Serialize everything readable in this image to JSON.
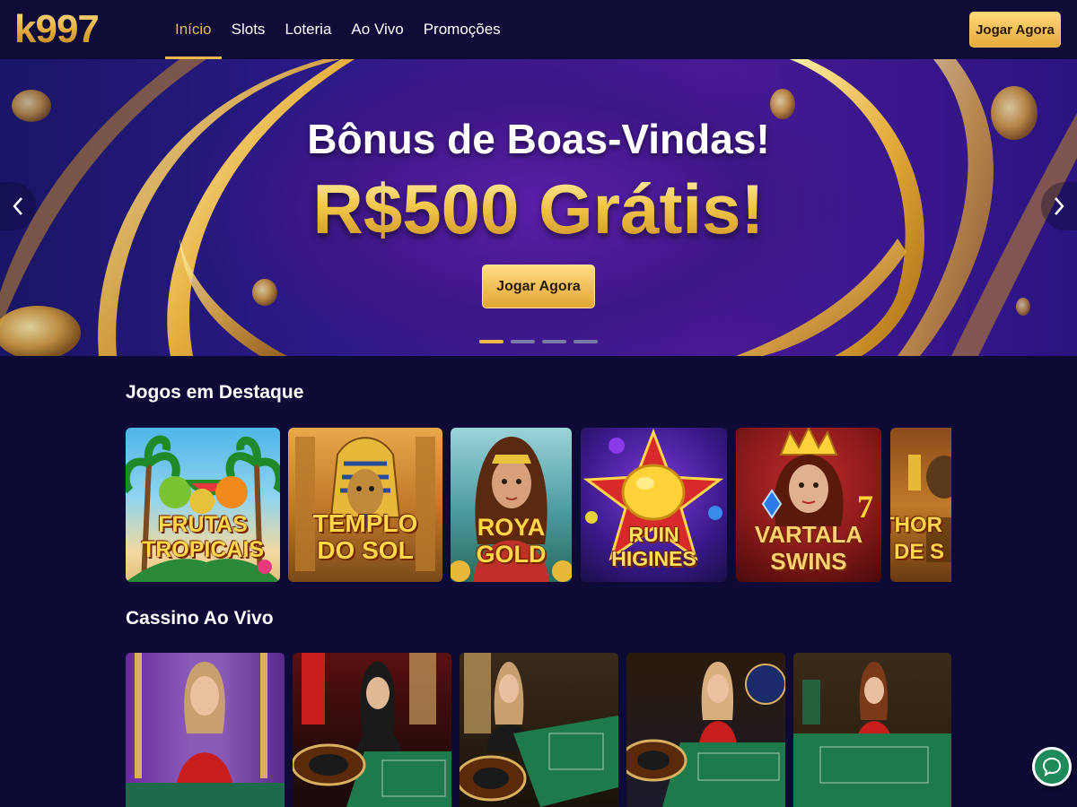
{
  "header": {
    "logo": "k997",
    "nav": [
      {
        "label": "Início",
        "active": true
      },
      {
        "label": "Slots",
        "active": false
      },
      {
        "label": "Loteria",
        "active": false
      },
      {
        "label": "Ao Vivo",
        "active": false
      },
      {
        "label": "Promoções",
        "active": false
      }
    ],
    "cta_label": "Jogar Agora"
  },
  "hero": {
    "title": "Bônus de Boas-Vindas!",
    "amount": "R$500 Grátis!",
    "cta_label": "Jogar Agora",
    "slides_count": 4,
    "active_slide": 1
  },
  "featured": {
    "title": "Jogos em Destaque",
    "games": [
      {
        "name_line1": "FRUTAS",
        "name_line2": "TROPICAIS"
      },
      {
        "name_line1": "TEMPLO",
        "name_line2": "DO SOL"
      },
      {
        "name_line1": "ROYA",
        "name_line2": "GOLD"
      },
      {
        "name_line1": "RUIN",
        "name_line2": "HIGINES"
      },
      {
        "name_line1": "VARTALA",
        "name_line2": "SWINS"
      },
      {
        "name_line1": "THOR",
        "name_line2": "DE S"
      }
    ]
  },
  "live": {
    "title": "Cassino Ao Vivo"
  },
  "colors": {
    "accent_gold": "#e8b84a",
    "background": "#0d0b35",
    "chat_green": "#1f8a5a"
  }
}
